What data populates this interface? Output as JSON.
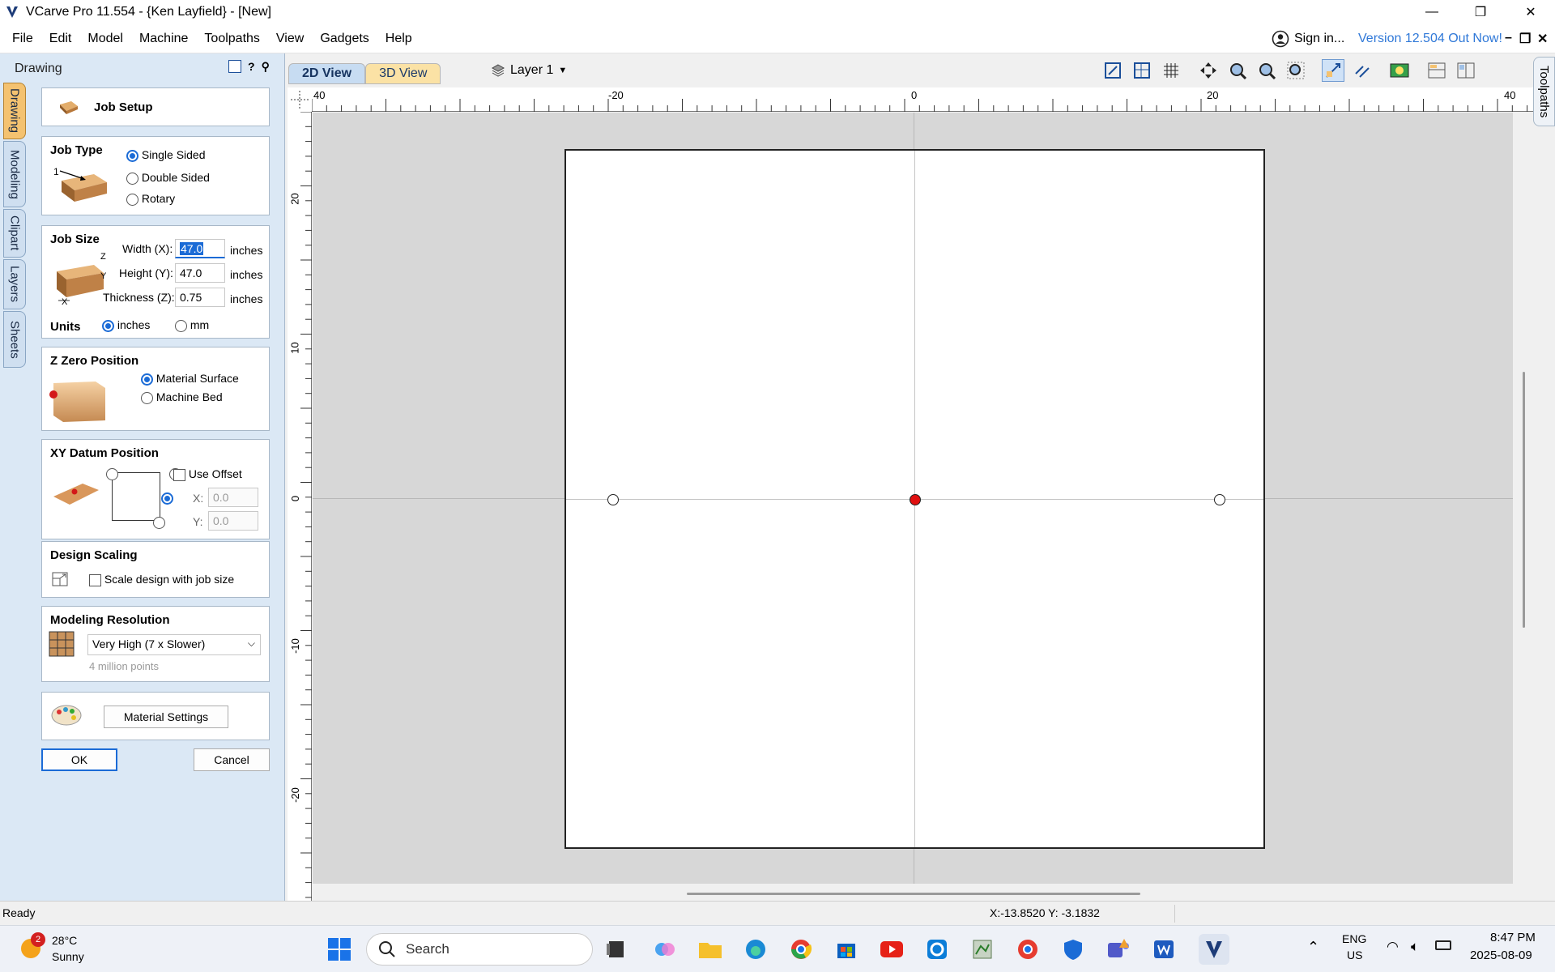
{
  "window": {
    "title": "VCarve Pro 11.554 - {Ken Layfield} - [New]",
    "minimize": "—",
    "restore": "❐",
    "close": "✕"
  },
  "menu": {
    "items": [
      "File",
      "Edit",
      "Model",
      "Machine",
      "Toolpaths",
      "View",
      "Gadgets",
      "Help"
    ],
    "sign_in": "Sign in...",
    "version_notice": "Version 12.504 Out Now!",
    "mdi_min": "–",
    "mdi_restore": "❐",
    "mdi_close": "✕"
  },
  "panel": {
    "header": "Drawing",
    "tool_help": "?",
    "tabs": [
      "Drawing",
      "Modeling",
      "Clipart",
      "Layers",
      "Sheets"
    ],
    "job_setup_title": "Job Setup",
    "job_type": {
      "title": "Job Type",
      "options": [
        "Single Sided",
        "Double Sided",
        "Rotary"
      ],
      "selected": "Single Sided",
      "icon_marker": "1"
    },
    "job_size": {
      "title": "Job Size",
      "width_label": "Width (X):",
      "width_value": "47.0",
      "height_label": "Height (Y):",
      "height_value": "47.0",
      "thickness_label": "Thickness (Z):",
      "thickness_value": "0.75",
      "unit": "inches",
      "units_title": "Units",
      "unit_options": [
        "inches",
        "mm"
      ],
      "unit_selected": "inches",
      "axis_z": "Z",
      "axis_y": "Y",
      "axis_x": "X"
    },
    "z_zero": {
      "title": "Z Zero Position",
      "options": [
        "Material Surface",
        "Machine Bed"
      ],
      "selected": "Material Surface"
    },
    "xy_datum": {
      "title": "XY Datum Position",
      "use_offset": "Use Offset",
      "x_label": "X:",
      "x_value": "0.0",
      "y_label": "Y:",
      "y_value": "0.0"
    },
    "design_scaling": {
      "title": "Design Scaling",
      "checkbox_label": "Scale design with job size"
    },
    "modeling_resolution": {
      "title": "Modeling Resolution",
      "selected": "Very High (7 x Slower)",
      "hint": "4 million points"
    },
    "material_settings": "Material Settings",
    "ok": "OK",
    "cancel": "Cancel"
  },
  "view": {
    "tab_2d": "2D View",
    "tab_3d": "3D View",
    "layer": "Layer 1",
    "ruler_h_labels": [
      "40",
      "-20",
      "0",
      "20",
      "40"
    ],
    "ruler_v_labels": [
      "20",
      "10",
      "0",
      "-10",
      "-20"
    ],
    "right_tab": "Toolpaths"
  },
  "status": {
    "left": "Ready",
    "coords": "X:-13.8520 Y: -3.1832"
  },
  "taskbar": {
    "weather_temp": "28°C",
    "weather_desc": "Sunny",
    "weather_badge": "2",
    "search": "Search",
    "lang_top": "ENG",
    "lang_bottom": "US",
    "time": "8:47 PM",
    "date": "2025-08-09"
  },
  "colors": {
    "panel_bg": "#dbe8f5",
    "accent_blue": "#1b6bd6",
    "tab_active": "#f4c270",
    "version_link": "#2f78d8",
    "datum_red": "#e01010"
  }
}
